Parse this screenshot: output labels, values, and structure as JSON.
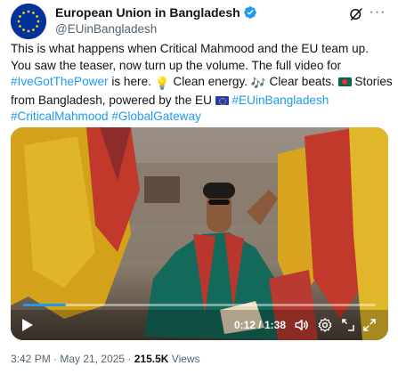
{
  "author": {
    "display_name": "European Union in Bangladesh",
    "handle": "@EUinBangladesh",
    "verified": true
  },
  "tweet": {
    "line1": "This is what happens when Critical Mahmood and the EU team up.",
    "line2": "You saw the teaser, now turn up the volume. The full video for",
    "hashtag1": "#IveGotThePower",
    "line3_a": " is here. ",
    "line3_b": " Clean energy. ",
    "line3_c": " Clear beats. ",
    "line3_d": " Stories",
    "line4_a": "from Bangladesh, powered by the EU ",
    "hashtag2": "#EUinBangladesh",
    "hashtag3": "#CriticalMahmood",
    "hashtag4": "#GlobalGateway",
    "emoji_bulb": "💡",
    "emoji_music": "🎶"
  },
  "video": {
    "time_current": "0:12",
    "time_total": "1:38",
    "time_display": "0:12 / 1:38",
    "progress_fraction": 0.122
  },
  "meta": {
    "time": "3:42 PM",
    "separator": " · ",
    "date": "May 21, 2025",
    "views_count": "215.5K",
    "views_label": " Views"
  },
  "colors": {
    "accent": "#1d9bf0",
    "text": "#0f1419",
    "muted": "#536471",
    "eu_blue": "#003399"
  },
  "icons": {
    "avatar": "eu-flag-avatar",
    "verified": "verified-badge-icon",
    "grok": "grok-icon",
    "more": "more-icon",
    "play": "play-icon",
    "volume": "volume-icon",
    "settings": "settings-icon",
    "exit": "picture-in-picture-icon",
    "fullscreen": "fullscreen-icon"
  }
}
